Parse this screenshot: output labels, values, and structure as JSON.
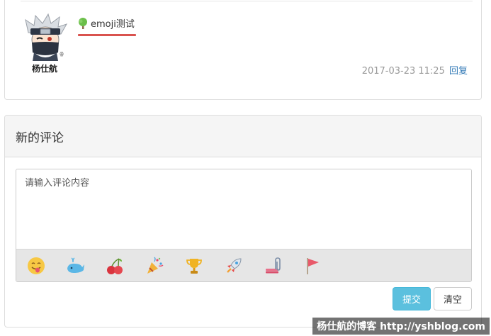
{
  "comment": {
    "author": "杨仕航",
    "text": "emoji测试",
    "timestamp": "2017-03-23 11:25",
    "reply_label": "回复",
    "icon": "tree-icon",
    "underline_color": "#d9534f"
  },
  "new_comment": {
    "title": "新的评论",
    "placeholder": "请输入评论内容",
    "value": "",
    "emojis": [
      {
        "icon": "smile-tongue-icon"
      },
      {
        "icon": "whale-icon"
      },
      {
        "icon": "cherries-icon"
      },
      {
        "icon": "party-popper-icon"
      },
      {
        "icon": "trophy-icon"
      },
      {
        "icon": "rocket-icon"
      },
      {
        "icon": "paperclip-icon"
      },
      {
        "icon": "flag-icon"
      }
    ],
    "submit_label": "提交",
    "clear_label": "清空"
  },
  "colors": {
    "submit_bg": "#5bc0de",
    "link": "#337ab7",
    "meta_text": "#999999",
    "heading_bg": "#f5f5f5"
  },
  "watermark": "杨仕航的博客 http://yshblog.com"
}
